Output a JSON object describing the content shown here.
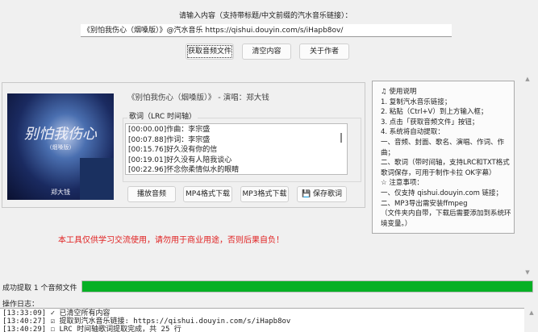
{
  "prompt_label": "请输入内容（支持带标题/中文前缀的汽水音乐链接）：",
  "url_value": "《别怕我伤心（烟嗓版）》@汽水音乐 https://qishui.douyin.com/s/iHapb8ov/",
  "buttons": {
    "fetch": "获取音频文件",
    "clear": "清空内容",
    "about": "关于作者"
  },
  "song": {
    "title_line": "《别怕我伤心（烟嗓版）》 - 演唱：郑大钱",
    "cover_title": "别怕我伤心",
    "cover_sub": "(烟嗓版)",
    "cover_artist": "郑大钱"
  },
  "lyrics": {
    "label": "歌词（LRC 时间轴）",
    "lines": [
      "[00:00.00]作曲：李宗盛",
      "[00:07.88]作词：李宗盛",
      "[00:15.76]好久没有你的信",
      "[00:19.01]好久没有人陪我谈心",
      "[00:22.96]怀念你柔情似水的眼睛"
    ]
  },
  "actions": {
    "play": "播放音频",
    "mp4": "MP4格式下载",
    "mp3": "MP3格式下载",
    "save": "保存歌词"
  },
  "help": {
    "lines": [
      "♫ 使用说明",
      "1. 复制汽水音乐链接；",
      "2. 粘贴（Ctrl+V）到上方输入框；",
      "3. 点击「获取音频文件」按钮；",
      "4. 系统将自动提取：",
      "一、音频、封面、歌名、演唱、作词、作曲；",
      "二、歌词（带时间轴，支持LRC和TXT格式 歌词保存，可用于制作卡拉 OK字幕）",
      "☆ 注意事项：",
      "一、仅支持 qishui.douyin.com 链接；",
      "二、MP3导出需安装ffmpeg",
      "（文件夹内自带，下载后需要添加到系统环境变量。）"
    ]
  },
  "warning": "本工具仅供学习交流使用，请勿用于商业用途，否则后果自负！",
  "status": {
    "text": "成功提取 1 个音频文件",
    "progress_percent": 100,
    "color": "#06b025"
  },
  "warning_color": "#e02020",
  "log": {
    "label": "操作日志：",
    "lines": [
      "[13:33:09] ✓ 已清空所有内容",
      "[13:40:27] ☑ 提取到汽水音乐链接: https://qishui.douyin.com/s/iHapb8ov",
      "[13:40:29] ☐ LRC 时间轴歌词提取完成，共 25 行"
    ]
  }
}
